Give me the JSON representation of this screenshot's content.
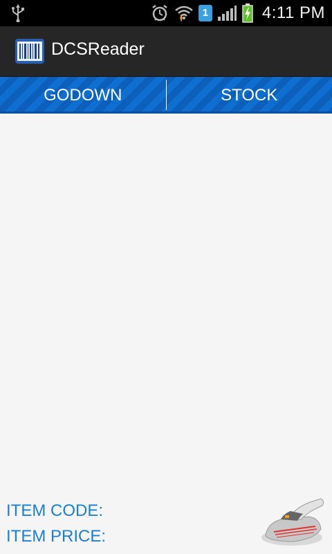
{
  "status_bar": {
    "icons": [
      "usb-icon",
      "alarm-icon",
      "wifi-icon",
      "sim-badge",
      "signal-icon",
      "battery-charging-icon"
    ],
    "sim_number": "1",
    "time": "4:11 PM"
  },
  "action_bar": {
    "app_icon": "barcode-icon",
    "title": "DCSReader"
  },
  "tabs": [
    {
      "label": "GODOWN"
    },
    {
      "label": "STOCK"
    }
  ],
  "content": {
    "item_code_label": "ITEM CODE:",
    "item_price_label": "ITEM PRICE:",
    "scanner_icon": "barcode-scanner-icon"
  },
  "colors": {
    "accent_blue": "#0f6fd0",
    "label_blue": "#1a7fd0",
    "action_bar_bg": "#262626",
    "background": "#f5f5f5"
  }
}
